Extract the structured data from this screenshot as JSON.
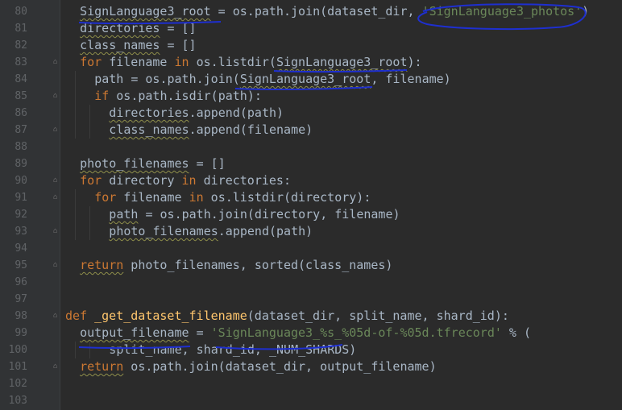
{
  "editor": {
    "lines": [
      {
        "num": "80",
        "fold": false,
        "indent": 1,
        "tokens": [
          {
            "t": "SignLanguage3_root",
            "c": "var"
          },
          {
            "t": " = os.path.join(dataset_dir, ",
            "c": "plain"
          },
          {
            "t": "'SignLanguage3_photos'",
            "c": "str"
          },
          {
            "t": ")",
            "c": "plain"
          }
        ]
      },
      {
        "num": "81",
        "fold": false,
        "indent": 1,
        "tokens": [
          {
            "t": "directories",
            "c": "wav"
          },
          {
            "t": " = []",
            "c": "plain"
          }
        ]
      },
      {
        "num": "82",
        "fold": false,
        "indent": 1,
        "tokens": [
          {
            "t": "class_names",
            "c": "wav"
          },
          {
            "t": " = []",
            "c": "plain"
          }
        ]
      },
      {
        "num": "83",
        "fold": true,
        "indent": 1,
        "tokens": [
          {
            "t": "for",
            "c": "kw"
          },
          {
            "t": " filename ",
            "c": "plain"
          },
          {
            "t": "in",
            "c": "kw"
          },
          {
            "t": " os.listdir(",
            "c": "plain"
          },
          {
            "t": "SignLanguage3_root",
            "c": "var"
          },
          {
            "t": "):",
            "c": "plain"
          }
        ]
      },
      {
        "num": "84",
        "fold": false,
        "indent": 2,
        "tokens": [
          {
            "t": "path = os.path.join(",
            "c": "plain"
          },
          {
            "t": "SignLanguage3_root",
            "c": "var"
          },
          {
            "t": ", filename)",
            "c": "plain"
          }
        ]
      },
      {
        "num": "85",
        "fold": true,
        "indent": 2,
        "tokens": [
          {
            "t": "if",
            "c": "kw"
          },
          {
            "t": " os.path.isdir(path):",
            "c": "plain"
          }
        ]
      },
      {
        "num": "86",
        "fold": false,
        "indent": 3,
        "tokens": [
          {
            "t": "directories",
            "c": "wav"
          },
          {
            "t": ".append(path)",
            "c": "plain"
          }
        ]
      },
      {
        "num": "87",
        "fold": true,
        "indent": 3,
        "tokens": [
          {
            "t": "class_names",
            "c": "wav"
          },
          {
            "t": ".append(filename)",
            "c": "plain"
          }
        ]
      },
      {
        "num": "88",
        "fold": false,
        "indent": 0,
        "tokens": []
      },
      {
        "num": "89",
        "fold": false,
        "indent": 1,
        "tokens": [
          {
            "t": "photo_filenames",
            "c": "wav"
          },
          {
            "t": " = []",
            "c": "plain"
          }
        ]
      },
      {
        "num": "90",
        "fold": true,
        "indent": 1,
        "tokens": [
          {
            "t": "for",
            "c": "kw"
          },
          {
            "t": " directory ",
            "c": "plain"
          },
          {
            "t": "in",
            "c": "kw"
          },
          {
            "t": " directories:",
            "c": "plain"
          }
        ]
      },
      {
        "num": "91",
        "fold": true,
        "indent": 2,
        "tokens": [
          {
            "t": "for",
            "c": "kw"
          },
          {
            "t": " filename ",
            "c": "plain"
          },
          {
            "t": "in",
            "c": "kw"
          },
          {
            "t": " os.listdir(directory):",
            "c": "plain"
          }
        ]
      },
      {
        "num": "92",
        "fold": false,
        "indent": 3,
        "tokens": [
          {
            "t": "path",
            "c": "wav"
          },
          {
            "t": " = os.path.join(directory, filename)",
            "c": "plain"
          }
        ]
      },
      {
        "num": "93",
        "fold": true,
        "indent": 3,
        "tokens": [
          {
            "t": "photo_filenames",
            "c": "wav"
          },
          {
            "t": ".append(path)",
            "c": "plain"
          }
        ]
      },
      {
        "num": "94",
        "fold": false,
        "indent": 0,
        "tokens": []
      },
      {
        "num": "95",
        "fold": true,
        "indent": 1,
        "tokens": [
          {
            "t": "return",
            "c": "kwwav"
          },
          {
            "t": " photo_filenames, sorted(class_names)",
            "c": "plain"
          }
        ]
      },
      {
        "num": "96",
        "fold": false,
        "indent": 0,
        "tokens": []
      },
      {
        "num": "97",
        "fold": false,
        "indent": 0,
        "tokens": []
      },
      {
        "num": "98",
        "fold": true,
        "indent": 0,
        "tokens": [
          {
            "t": "def",
            "c": "kw"
          },
          {
            "t": " ",
            "c": "plain"
          },
          {
            "t": "_get_dataset_filename",
            "c": "fn"
          },
          {
            "t": "(dataset_dir, split_name, shard_id):",
            "c": "plain"
          }
        ]
      },
      {
        "num": "99",
        "fold": false,
        "indent": 1,
        "tokens": [
          {
            "t": "output_filename",
            "c": "wav"
          },
          {
            "t": " = ",
            "c": "plain"
          },
          {
            "t": "'SignLanguage3_%s_%05d-of-%05d.tfrecord'",
            "c": "str"
          },
          {
            "t": " % (",
            "c": "plain"
          }
        ]
      },
      {
        "num": "100",
        "fold": false,
        "indent": 3,
        "tokens": [
          {
            "t": "split_name, shard_id, _NUM_SHARDS)",
            "c": "plain"
          }
        ]
      },
      {
        "num": "101",
        "fold": true,
        "indent": 1,
        "tokens": [
          {
            "t": "return",
            "c": "kwwav"
          },
          {
            "t": " os.path.join(dataset_dir, output_filename)",
            "c": "plain"
          }
        ]
      },
      {
        "num": "102",
        "fold": false,
        "indent": 0,
        "tokens": []
      },
      {
        "num": "103",
        "fold": false,
        "indent": 0,
        "tokens": []
      }
    ]
  },
  "colors": {
    "background": "#2b2b2b",
    "gutter": "#313335",
    "keyword": "#cc7832",
    "string": "#6a8759",
    "function": "#ffc66d",
    "text": "#a9b7c6",
    "annotation_ink": "#1e2fd0"
  }
}
